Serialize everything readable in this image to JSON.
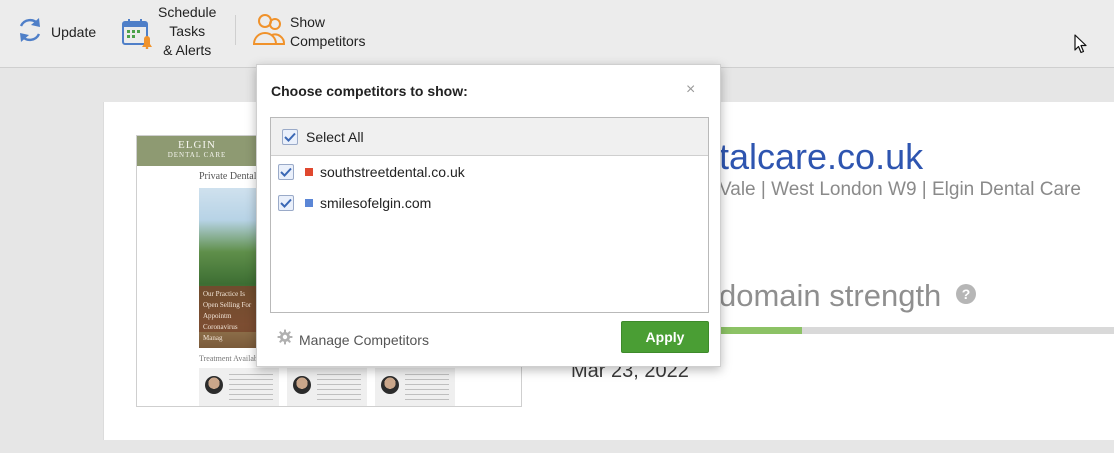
{
  "toolbar": {
    "update_label": "Update",
    "schedule_label_line1": "Schedule",
    "schedule_label_line2": "Tasks",
    "schedule_label_line3": "& Alerts",
    "competitors_label_line1": "Show",
    "competitors_label_line2": "Competitors"
  },
  "main": {
    "domain_title": "talcare.co.uk",
    "domain_subtitle": "Vale | West London W9 | Elgin Dental Care",
    "strength_label": "domain strength",
    "strength_fraction": 0.21,
    "help_glyph": "?",
    "date": "Mar 23, 2022",
    "thumbnail": {
      "brand": "ELGIN",
      "brand_sub": "DENTAL CARE",
      "heading": "Private Dental P",
      "overlay_text": "Our Practice Is Open Selling For Appointm Coronavirus Manag",
      "footer_text": "Treatment Availability"
    }
  },
  "popup": {
    "title": "Choose competitors to show:",
    "close_glyph": "×",
    "select_all_label": "Select All",
    "competitors": [
      {
        "name": "southstreetdental.co.uk",
        "color": "#e0482f",
        "checked": true
      },
      {
        "name": "smilesofelgin.com",
        "color": "#5b86d6",
        "checked": true
      }
    ],
    "manage_label": "Manage Competitors",
    "apply_label": "Apply"
  },
  "colors": {
    "accent_blue": "#2e55b0",
    "apply_green": "#4a9e34",
    "strength_green": "#8cc265",
    "icon_orange": "#f0922b",
    "icon_blue": "#4f7fc8"
  }
}
